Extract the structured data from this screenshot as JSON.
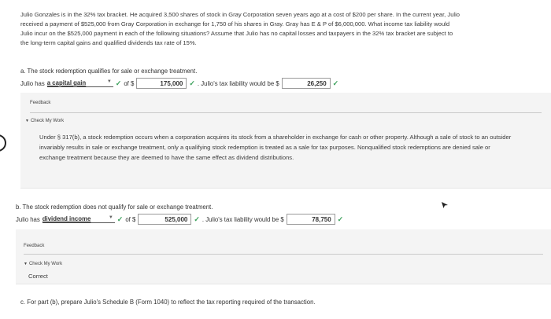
{
  "intro": "Julio Gonzales is in the 32% tax bracket. He acquired 3,500 shares of stock in Gray Corporation seven years ago at a cost of $200 per share. In the current year, Julio received a payment of $525,000 from Gray Corporation in exchange for 1,750 of his shares in Gray. Gray has E & P of $6,000,000. What income tax liability would Julio incur on the $525,000 payment in each of the following situations? Assume that Julio has no capital losses and taxpayers in the 32% tax bracket are subject to the long-term capital gains and qualified dividends tax rate of 15%.",
  "part_a": {
    "prompt": "a. The stock redemption qualifies for sale or exchange treatment.",
    "lead": "Julio has",
    "selection": "a capital gain",
    "of_label": "of $",
    "amount": "175,000",
    "liability_label": ". Julio's tax liability would be $",
    "liability": "26,250",
    "feedback_label": "Feedback",
    "check_my_work": "Check My Work",
    "feedback_text": "Under § 317(b), a stock redemption occurs when a corporation acquires its stock from a shareholder in exchange for cash or other property. Although a sale of stock to an outsider invariably results in sale or exchange treatment, only a qualifying stock redemption is treated as a sale for tax purposes. Nonqualified stock redemptions are denied sale or exchange treatment because they are deemed to have the same effect as dividend distributions."
  },
  "part_b": {
    "prompt": "b. The stock redemption does not qualify for sale or exchange treatment.",
    "lead": "Julio has",
    "selection": "dividend income",
    "of_label": "of $",
    "amount": "525,000",
    "liability_label": ". Julio's tax liability would be $",
    "liability": "78,750",
    "feedback_label": "Feedback",
    "check_my_work": "Check My Work",
    "feedback_text": "Correct"
  },
  "part_c": {
    "prompt": "c. For part (b), prepare Julio's Schedule B (Form 1040) to reflect the tax reporting required of the transaction."
  },
  "icons": {
    "check": "✓",
    "caret": "▼",
    "triangle": "▼"
  },
  "colors": {
    "check_green": "#3aa05a",
    "panel_bg": "#f4f4f4"
  }
}
